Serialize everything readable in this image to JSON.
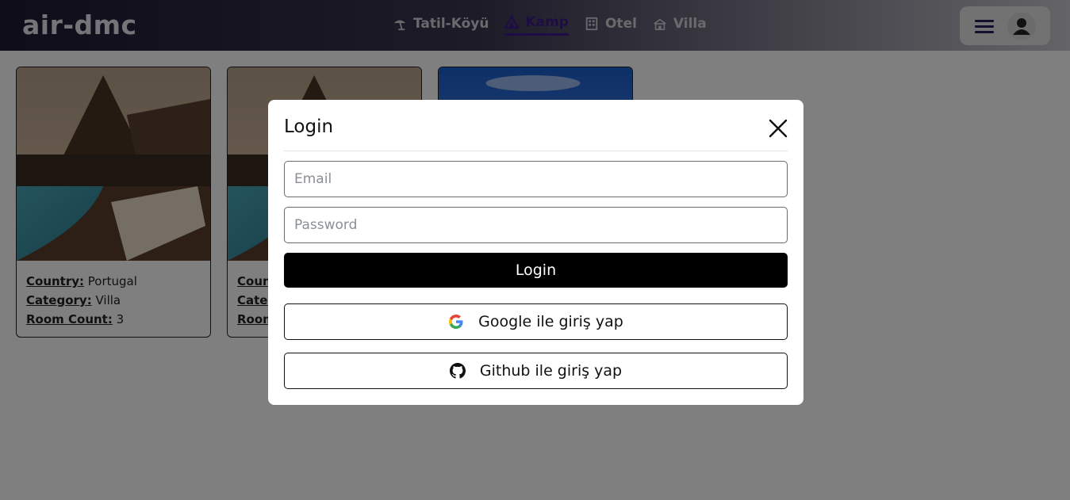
{
  "header": {
    "logo": "air-dmc",
    "nav": [
      {
        "label": "Tatil-Köyü",
        "icon": "beach-umbrella-icon",
        "active": false
      },
      {
        "label": "Kamp",
        "icon": "tent-icon",
        "active": true
      },
      {
        "label": "Otel",
        "icon": "hotel-icon",
        "active": false
      },
      {
        "label": "Villa",
        "icon": "villa-icon",
        "active": false
      }
    ],
    "menu_icon": "hamburger-menu-icon",
    "user_icon": "user-avatar-icon"
  },
  "cards": [
    {
      "country_label": "Country:",
      "country": "Portugal",
      "category_label": "Category:",
      "category": "Villa",
      "rooms_label": "Room Count:",
      "rooms": "3"
    },
    {
      "country_label": "Coun",
      "category_label": "Categ",
      "rooms_label": "Room"
    },
    {}
  ],
  "modal": {
    "title": "Login",
    "email_placeholder": "Email",
    "password_placeholder": "Password",
    "login_label": "Login",
    "google_label": "Google ile giriş yap",
    "github_label": "Github ile giriş yap"
  },
  "colors": {
    "active_nav": "#3d1a8a",
    "primary_button": "#000000",
    "overlay": "rgba(0,0,0,0.5)"
  }
}
